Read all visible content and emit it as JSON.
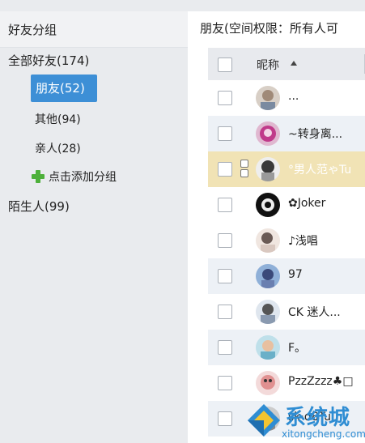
{
  "sidebar": {
    "title": "好友分组",
    "groups": [
      {
        "label": "全部好友(174)"
      },
      {
        "label": "朋友(52)"
      },
      {
        "label": "其他(94)"
      },
      {
        "label": "亲人(28)"
      },
      {
        "label": "点击添加分组"
      },
      {
        "label": "陌生人(99)"
      }
    ]
  },
  "main": {
    "title": "朋友(空间权限：所有人可",
    "column_header": "昵称",
    "contacts": [
      {
        "nickname": "...",
        "avatar_color": "#c8b4a0"
      },
      {
        "nickname": "~转身离...",
        "avatar_color": "#c03a8a"
      },
      {
        "nickname": "°男人范ゃTu",
        "avatar_color": "#6f6f6f"
      },
      {
        "nickname": "✿Joker",
        "avatar_color": "#1a1a1a"
      },
      {
        "nickname": "♪浅唱",
        "avatar_color": "#d9c8c0"
      },
      {
        "nickname": "97",
        "avatar_color": "#6a7fb0"
      },
      {
        "nickname": "CK 迷人...",
        "avatar_color": "#8a9ab0"
      },
      {
        "nickname": "F。",
        "avatar_color": "#6ab0c8"
      },
      {
        "nickname": "PzzZzzz♣□",
        "avatar_color": "#c89a9a"
      },
      {
        "nickname": "sk·d8Tu",
        "avatar_color": "#555555"
      }
    ]
  },
  "watermark": {
    "text": "系统城",
    "url": "xitongcheng.com"
  }
}
